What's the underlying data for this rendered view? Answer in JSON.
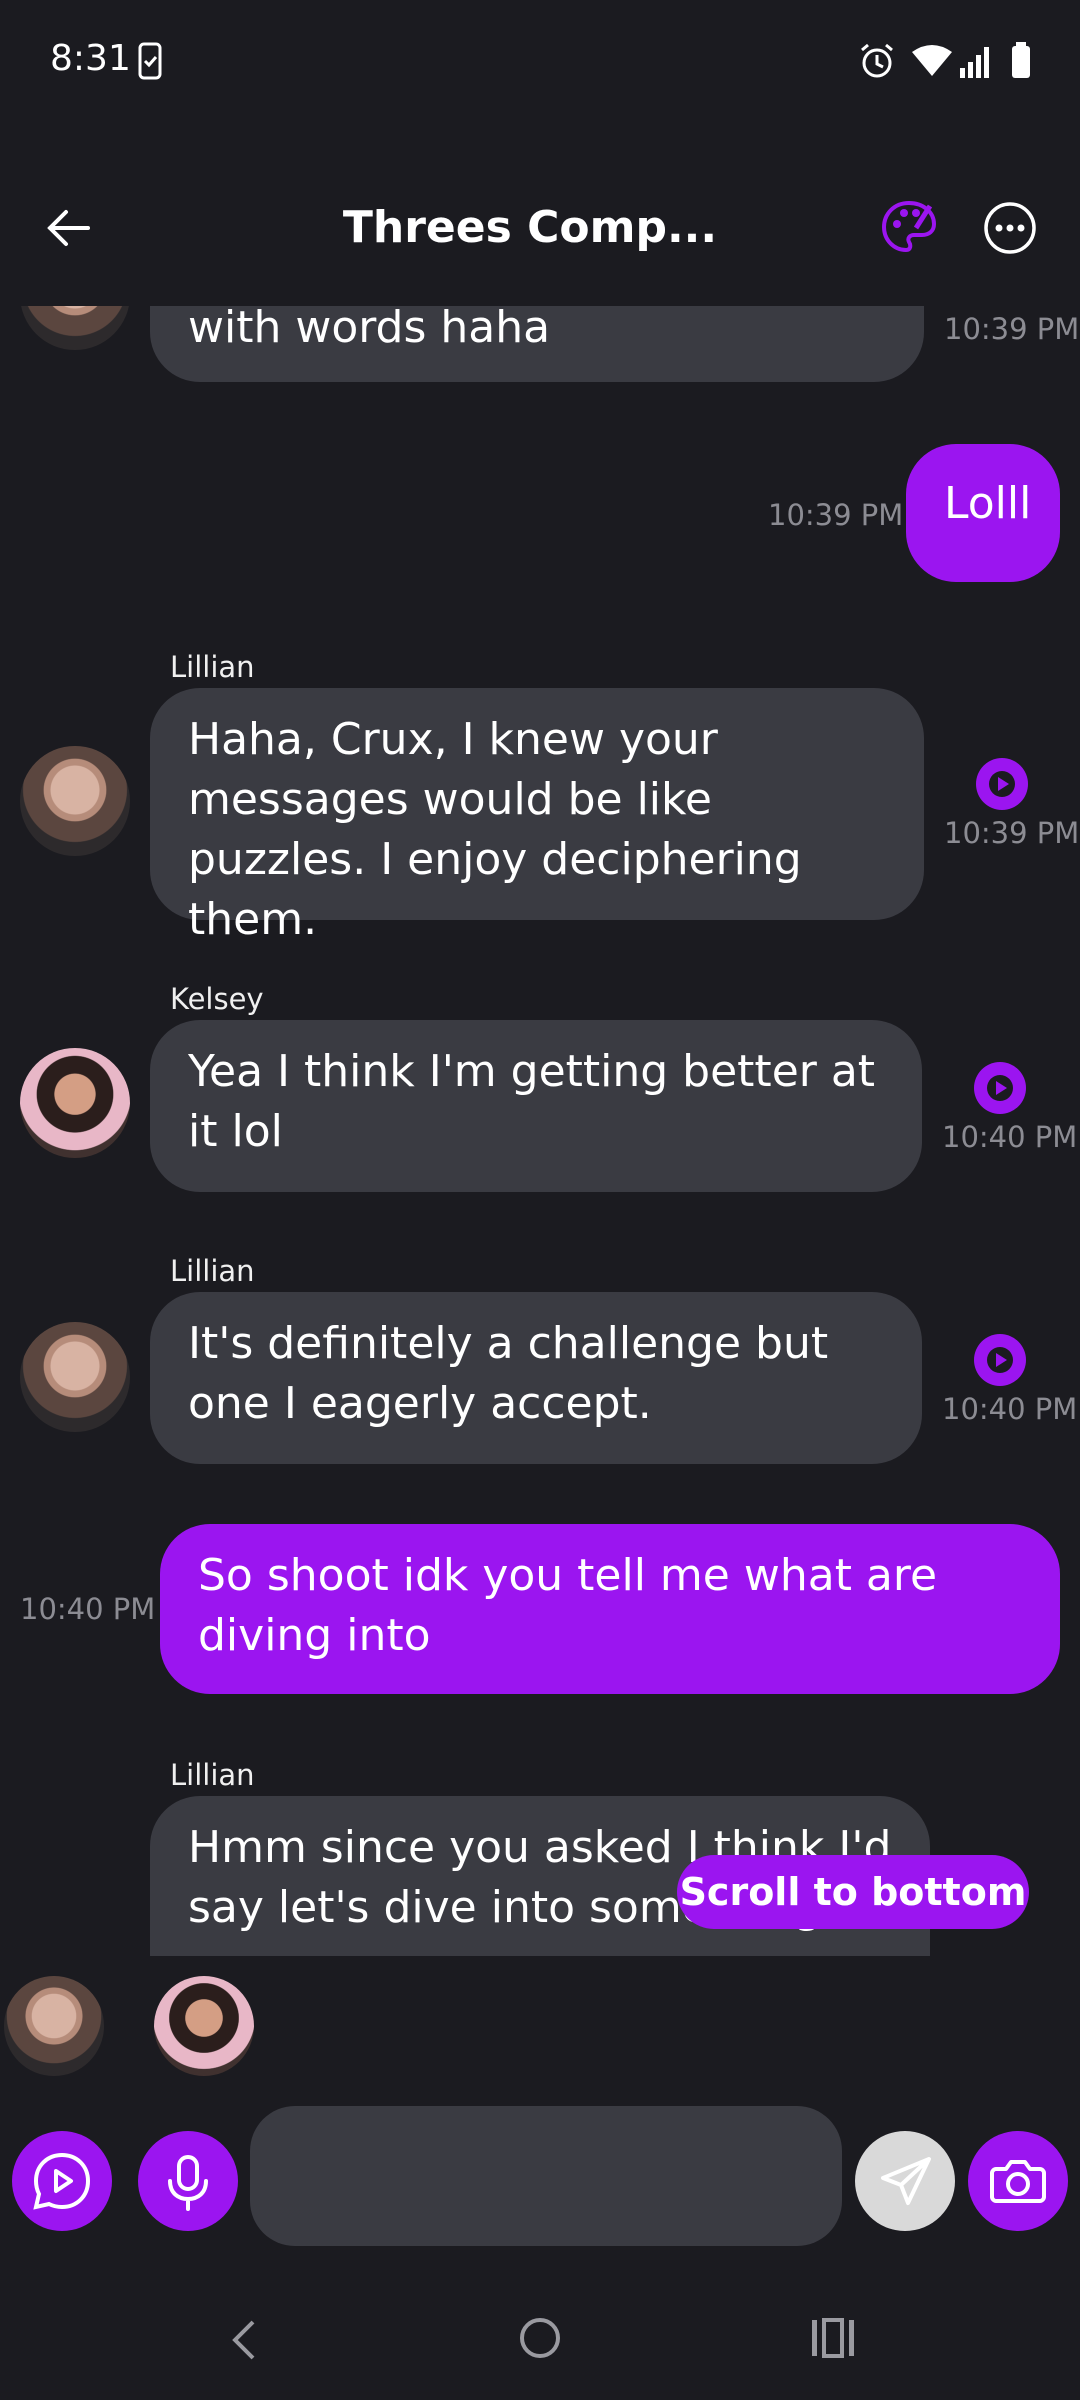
{
  "status_bar": {
    "time": "8:31"
  },
  "header": {
    "title": "Threes Comp..."
  },
  "messages": [
    {
      "type": "bot",
      "sender": "",
      "text": "with words haha",
      "time": "10:39 PM",
      "avatar": "lillian"
    },
    {
      "type": "user",
      "text": "Lolll",
      "time": "10:39 PM"
    },
    {
      "type": "bot",
      "sender": "Lillian",
      "text": "Haha, Crux, I knew your messages would be like puzzles. I enjoy deciphering them.",
      "time": "10:39 PM",
      "avatar": "lillian"
    },
    {
      "type": "bot",
      "sender": "Kelsey",
      "text": "Yea I think I'm getting better at it lol",
      "time": "10:40 PM",
      "avatar": "kelsey"
    },
    {
      "type": "bot",
      "sender": "Lillian",
      "text": "It's definitely a challenge but one I eagerly accept.",
      "time": "10:40 PM",
      "avatar": "lillian"
    },
    {
      "type": "user",
      "text": "So shoot idk you tell me what are diving into",
      "time": "10:40 PM"
    },
    {
      "type": "bot",
      "sender": "Lillian",
      "text": "Hmm since you asked I think I'd say let's dive into something",
      "time": "",
      "avatar": "lillian"
    }
  ],
  "scroll_button": {
    "label": "Scroll to bottom"
  },
  "participants": [
    "Lillian",
    "Kelsey"
  ],
  "composer": {
    "placeholder": ""
  },
  "colors": {
    "accent": "#9b15f0",
    "background": "#1b1b20",
    "bubble": "#3a3b42"
  }
}
